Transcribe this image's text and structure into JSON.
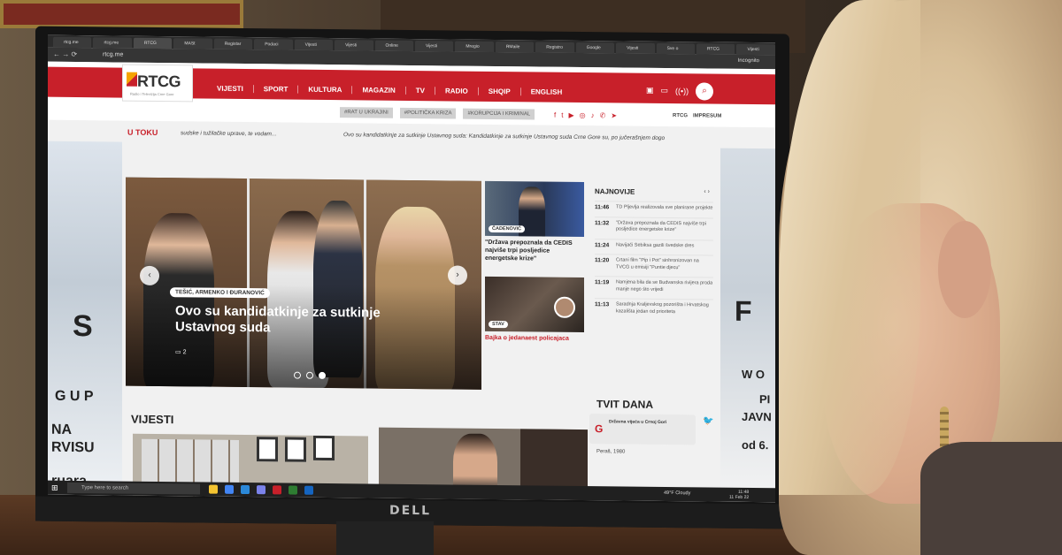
{
  "browser": {
    "tabs": [
      "rtcg.me",
      "rtcg.me",
      "RTCG",
      "MASt",
      "Registar",
      "Podaci",
      "Vijesti",
      "Vijesti",
      "Online",
      "Vijesti",
      "Mregio",
      "RMaile",
      "Registro",
      "Google",
      "Vijesti",
      "Sve o",
      "RTCG",
      "Vijesti"
    ],
    "url": "rtcg.me",
    "profile": "Incognito"
  },
  "site": {
    "logo": "RTCG",
    "logo_sub": "Radio i Televizija Crne Gore",
    "nav": [
      "VIJESTI",
      "SPORT",
      "KULTURA",
      "MAGAZIN",
      "TV",
      "RADIO",
      "SHQIP",
      "ENGLISH"
    ],
    "hashtags": [
      "#RAT U UKRAJINI",
      "#POLITIČKA KRIZA",
      "#KORUPCIJA I KRIMINAL"
    ],
    "header_links": [
      "RTCG",
      "IMPRESUM"
    ],
    "ticker_label": "U TOKU",
    "ticker_text": "sudske i tužilačke uprave, te vodam...",
    "ticker_text2": "Ovo su kandidatkinje za sutkinje Ustavnog suda: Kandidatkinje za sutkinje Ustavnog suda Crne Gore su, po jučerašnjem dogo"
  },
  "hero": {
    "tag": "TEŠIĆ, ARMENKO I ĐURANOVIĆ",
    "title": "Ovo su kandidatkinje za sutkinje Ustavnog suda",
    "comments": "2"
  },
  "side_stories": [
    {
      "tag": "ČADENOVIĆ",
      "title": "\"Država prepoznala da CEDIS najviše trpi posljedice energetske krize\"",
      "red": false
    },
    {
      "tag": "STAV",
      "title": "Bajka o jedanaest policajaca",
      "red": true
    }
  ],
  "latest": {
    "heading": "NAJNOVIJE",
    "items": [
      {
        "time": "11:46",
        "text": "TD Pljevlja realizovala sve planirane projekte"
      },
      {
        "time": "11:32",
        "text": "\"Država prepoznala da CEDIS najviše trpi posljedice energetske krize\""
      },
      {
        "time": "11:24",
        "text": "Navijači Sebiksa gazili švedske dres"
      },
      {
        "time": "11:20",
        "text": "Crtani film \"Pip i Pot\" sinhronizovan na TVCG u emisiji \"Puntie djecu\""
      },
      {
        "time": "11:19",
        "text": "Namjena bila da se Budvanska rivijera proda manje nego što vrijedi"
      },
      {
        "time": "11:13",
        "text": "Saradnja Kraljevskog pozorišta i Hrvatskog kazališta jedan od prioriteta"
      }
    ]
  },
  "tvit": {
    "heading": "TVIT DANA",
    "account": "Državna vijeća u Crnoj Gori",
    "text": "Peraš, 1980"
  },
  "vijesti_heading": "VIJESTI",
  "ads": {
    "left_lines": [
      "S",
      "G U P",
      "NA",
      "RVISU",
      "ruara"
    ],
    "right_lines": [
      "F",
      "W O",
      "PI",
      "JAVN",
      "od 6."
    ]
  },
  "taskbar": {
    "search_placeholder": "Type here to search",
    "weather": "49°F Cloudy",
    "time": "11:48",
    "date": "11 Feb 22"
  },
  "monitor_brand": "DELL"
}
